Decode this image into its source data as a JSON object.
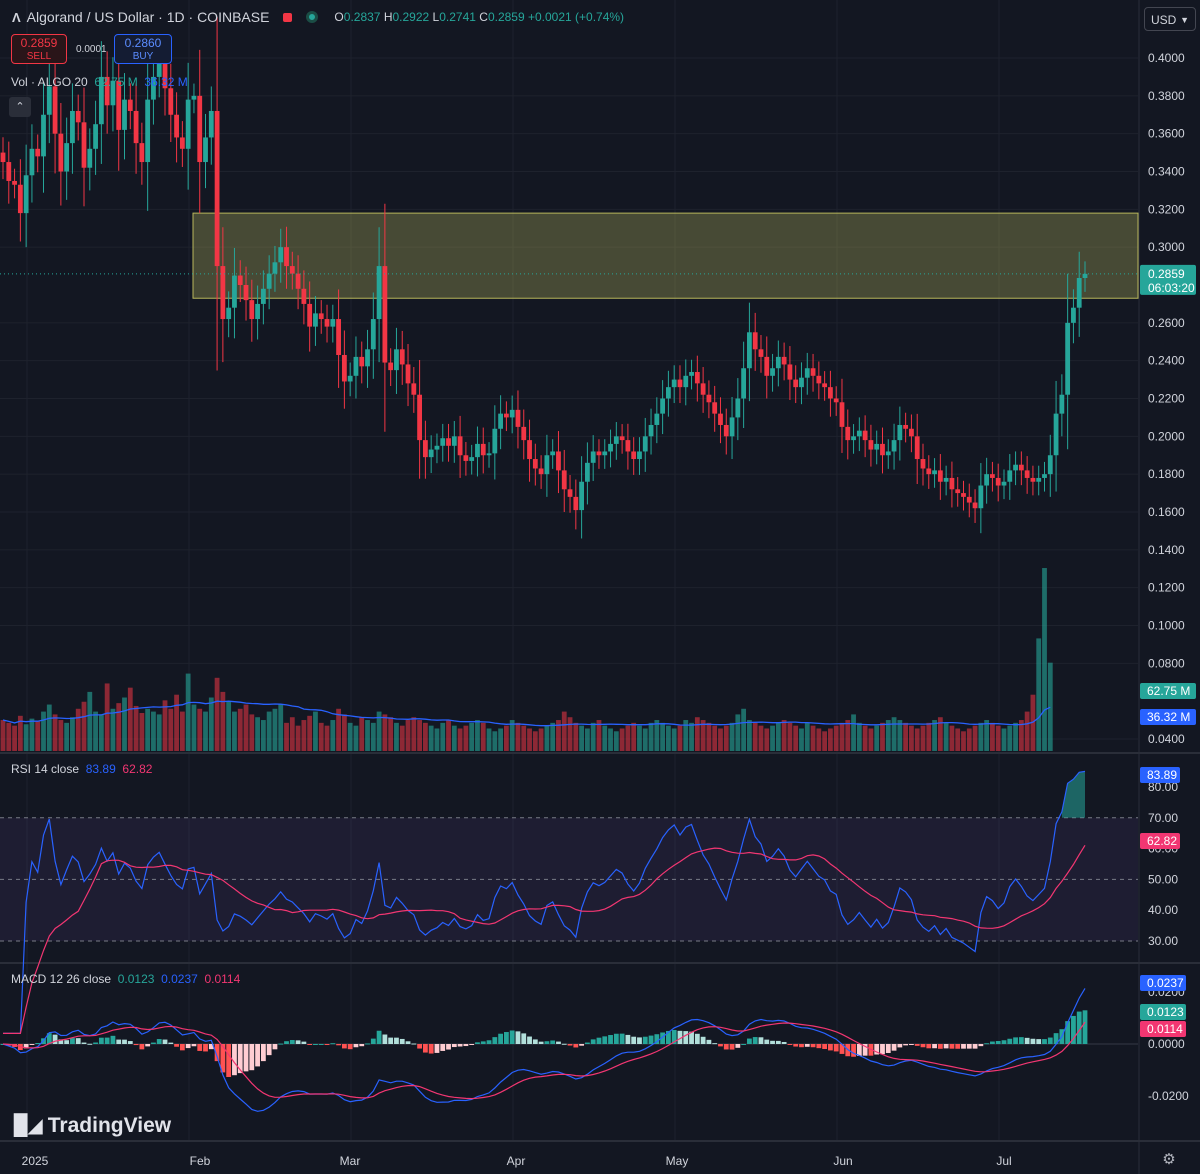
{
  "header": {
    "title": "Algorand / US Dollar · 1D · COINBASE",
    "o_label": "O",
    "o": "0.2837",
    "h_label": "H",
    "h": "0.2922",
    "l_label": "L",
    "l": "0.2741",
    "c_label": "C",
    "c": "0.2859",
    "change": "+0.0021 (+0.74%)"
  },
  "trade": {
    "sell_price": "0.2859",
    "sell_label": "SELL",
    "buy_price": "0.2860",
    "buy_label": "BUY",
    "spread": "0.0001"
  },
  "currency": "USD",
  "vol_legend": {
    "label": "Vol · ALGO 20",
    "v1": "62.75 M",
    "v2": "36.32 M"
  },
  "rsi_legend": {
    "label": "RSI 14 close",
    "v1": "83.89",
    "v2": "62.82"
  },
  "macd_legend": {
    "label": "MACD 12 26 close",
    "v1": "0.0123",
    "v2": "0.0237",
    "v3": "0.0114"
  },
  "brand": "TradingView",
  "colors": {
    "up": "#26a69a",
    "down": "#f23645",
    "vol_ma": "#2962ff",
    "rsi": "#2962ff",
    "rsi_ma": "#f23672",
    "macd": "#2962ff",
    "signal": "#f23672",
    "zone": "#b8b75c"
  },
  "chart_data": [
    {
      "type": "candlestick",
      "title": "Algorand / US Dollar · 1D · COINBASE",
      "ylim": [
        0.03,
        0.41
      ],
      "y_ticks": [
        "0.4000",
        "0.3800",
        "0.3600",
        "0.3400",
        "0.3200",
        "0.3000",
        "0.2600",
        "0.2400",
        "0.2200",
        "0.2000",
        "0.1800",
        "0.1600",
        "0.1400",
        "0.1200",
        "0.1000",
        "0.0800",
        "0.0400"
      ],
      "x_labels": [
        "2025",
        "Feb",
        "Mar",
        "Apr",
        "May",
        "Jun",
        "Jul"
      ],
      "last_price": "0.2859",
      "countdown": "06:03:20",
      "zone": {
        "top": 0.318,
        "bottom": 0.273
      },
      "dates_start": "2024-12-21",
      "close": [
        0.345,
        0.335,
        0.333,
        0.318,
        0.338,
        0.352,
        0.348,
        0.37,
        0.385,
        0.36,
        0.34,
        0.355,
        0.372,
        0.366,
        0.342,
        0.352,
        0.365,
        0.39,
        0.375,
        0.388,
        0.362,
        0.378,
        0.372,
        0.355,
        0.345,
        0.378,
        0.39,
        0.398,
        0.384,
        0.37,
        0.358,
        0.352,
        0.378,
        0.38,
        0.345,
        0.358,
        0.372,
        0.29,
        0.262,
        0.268,
        0.285,
        0.28,
        0.272,
        0.262,
        0.27,
        0.278,
        0.286,
        0.292,
        0.3,
        0.29,
        0.286,
        0.278,
        0.27,
        0.258,
        0.265,
        0.262,
        0.258,
        0.262,
        0.243,
        0.229,
        0.232,
        0.242,
        0.237,
        0.246,
        0.262,
        0.29,
        0.239,
        0.235,
        0.246,
        0.238,
        0.228,
        0.222,
        0.198,
        0.189,
        0.193,
        0.195,
        0.199,
        0.195,
        0.2,
        0.19,
        0.187,
        0.189,
        0.196,
        0.19,
        0.191,
        0.204,
        0.212,
        0.21,
        0.214,
        0.205,
        0.198,
        0.188,
        0.183,
        0.18,
        0.19,
        0.192,
        0.182,
        0.172,
        0.168,
        0.161,
        0.176,
        0.186,
        0.192,
        0.19,
        0.192,
        0.196,
        0.2,
        0.198,
        0.192,
        0.188,
        0.192,
        0.2,
        0.206,
        0.212,
        0.22,
        0.226,
        0.23,
        0.226,
        0.232,
        0.234,
        0.228,
        0.222,
        0.218,
        0.212,
        0.206,
        0.2,
        0.21,
        0.22,
        0.236,
        0.255,
        0.246,
        0.242,
        0.232,
        0.236,
        0.242,
        0.238,
        0.23,
        0.226,
        0.231,
        0.236,
        0.232,
        0.228,
        0.226,
        0.22,
        0.218,
        0.205,
        0.198,
        0.2,
        0.203,
        0.198,
        0.193,
        0.196,
        0.19,
        0.192,
        0.198,
        0.206,
        0.204,
        0.2,
        0.188,
        0.183,
        0.18,
        0.182,
        0.176,
        0.178,
        0.172,
        0.17,
        0.168,
        0.165,
        0.162,
        0.174,
        0.18,
        0.178,
        0.174,
        0.176,
        0.182,
        0.185,
        0.182,
        0.178,
        0.176,
        0.178,
        0.18,
        0.19,
        0.212,
        0.222,
        0.26,
        0.268,
        0.2837,
        0.2859
      ],
      "open": [
        0.35,
        0.345,
        0.335,
        0.333,
        0.318,
        0.338,
        0.352,
        0.348,
        0.37,
        0.385,
        0.36,
        0.34,
        0.355,
        0.372,
        0.366,
        0.342,
        0.352,
        0.365,
        0.39,
        0.375,
        0.388,
        0.362,
        0.378,
        0.372,
        0.355,
        0.345,
        0.378,
        0.39,
        0.398,
        0.384,
        0.37,
        0.358,
        0.352,
        0.378,
        0.38,
        0.345,
        0.358,
        0.372,
        0.29,
        0.262,
        0.268,
        0.285,
        0.28,
        0.272,
        0.262,
        0.27,
        0.278,
        0.286,
        0.292,
        0.3,
        0.29,
        0.286,
        0.278,
        0.27,
        0.258,
        0.265,
        0.262,
        0.258,
        0.262,
        0.243,
        0.229,
        0.232,
        0.242,
        0.237,
        0.246,
        0.262,
        0.29,
        0.239,
        0.235,
        0.246,
        0.238,
        0.228,
        0.222,
        0.198,
        0.189,
        0.193,
        0.195,
        0.199,
        0.195,
        0.2,
        0.19,
        0.187,
        0.189,
        0.196,
        0.19,
        0.191,
        0.204,
        0.212,
        0.21,
        0.214,
        0.205,
        0.198,
        0.188,
        0.183,
        0.18,
        0.19,
        0.192,
        0.182,
        0.172,
        0.168,
        0.161,
        0.176,
        0.186,
        0.192,
        0.19,
        0.192,
        0.196,
        0.2,
        0.198,
        0.192,
        0.188,
        0.192,
        0.2,
        0.206,
        0.212,
        0.22,
        0.226,
        0.23,
        0.226,
        0.232,
        0.234,
        0.228,
        0.222,
        0.218,
        0.212,
        0.206,
        0.2,
        0.21,
        0.22,
        0.236,
        0.255,
        0.246,
        0.242,
        0.232,
        0.236,
        0.242,
        0.238,
        0.23,
        0.226,
        0.231,
        0.236,
        0.232,
        0.228,
        0.226,
        0.22,
        0.218,
        0.205,
        0.198,
        0.2,
        0.203,
        0.198,
        0.193,
        0.196,
        0.19,
        0.192,
        0.198,
        0.206,
        0.204,
        0.2,
        0.188,
        0.183,
        0.18,
        0.182,
        0.176,
        0.178,
        0.172,
        0.17,
        0.168,
        0.165,
        0.162,
        0.174,
        0.18,
        0.178,
        0.174,
        0.176,
        0.182,
        0.185,
        0.182,
        0.178,
        0.176,
        0.178,
        0.18,
        0.19,
        0.212,
        0.222,
        0.26,
        0.268,
        0.2837
      ],
      "volume_m": [
        22,
        20,
        18,
        25,
        19,
        23,
        21,
        28,
        33,
        26,
        22,
        20,
        24,
        30,
        35,
        42,
        28,
        26,
        48,
        30,
        34,
        38,
        45,
        32,
        27,
        30,
        28,
        26,
        36,
        30,
        40,
        28,
        55,
        33,
        30,
        28,
        38,
        52,
        42,
        35,
        28,
        30,
        33,
        26,
        24,
        22,
        28,
        30,
        33,
        20,
        24,
        18,
        22,
        25,
        28,
        20,
        18,
        22,
        30,
        26,
        20,
        18,
        24,
        22,
        20,
        28,
        26,
        24,
        20,
        18,
        22,
        24,
        22,
        20,
        18,
        16,
        20,
        22,
        18,
        16,
        18,
        20,
        22,
        20,
        16,
        14,
        16,
        18,
        22,
        20,
        18,
        16,
        14,
        16,
        18,
        20,
        22,
        28,
        24,
        20,
        18,
        16,
        20,
        22,
        18,
        16,
        14,
        16,
        18,
        20,
        18,
        16,
        20,
        22,
        20,
        18,
        16,
        18,
        22,
        20,
        24,
        22,
        20,
        18,
        16,
        18,
        20,
        26,
        30,
        22,
        20,
        18,
        16,
        18,
        20,
        22,
        20,
        18,
        16,
        20,
        18,
        16,
        14,
        16,
        18,
        20,
        22,
        26,
        20,
        18,
        16,
        18,
        20,
        22,
        24,
        22,
        20,
        18,
        16,
        18,
        20,
        22,
        24,
        20,
        18,
        16,
        14,
        16,
        18,
        20,
        22,
        20,
        18,
        16,
        18,
        20,
        22,
        28,
        40,
        80,
        130,
        62.75
      ],
      "volume_ma_m": 36.32
    },
    {
      "type": "line",
      "title": "RSI 14 close",
      "ylim": [
        25,
        90
      ],
      "y_ticks": [
        "80.00",
        "70.00",
        "60.00",
        "50.00",
        "40.00",
        "30.00"
      ],
      "levels": [
        70,
        50,
        30
      ],
      "series": [
        {
          "name": "RSI",
          "last": 83.89
        },
        {
          "name": "RSI MA",
          "last": 62.82
        }
      ]
    },
    {
      "type": "bar",
      "title": "MACD 12 26 close",
      "ylim": [
        -0.028,
        0.028
      ],
      "y_ticks": [
        "0.0200",
        "0.0000",
        "-0.0200"
      ],
      "series": [
        {
          "name": "Histogram",
          "last": 0.0123
        },
        {
          "name": "MACD",
          "last": 0.0237
        },
        {
          "name": "Signal",
          "last": 0.0114
        }
      ]
    }
  ]
}
